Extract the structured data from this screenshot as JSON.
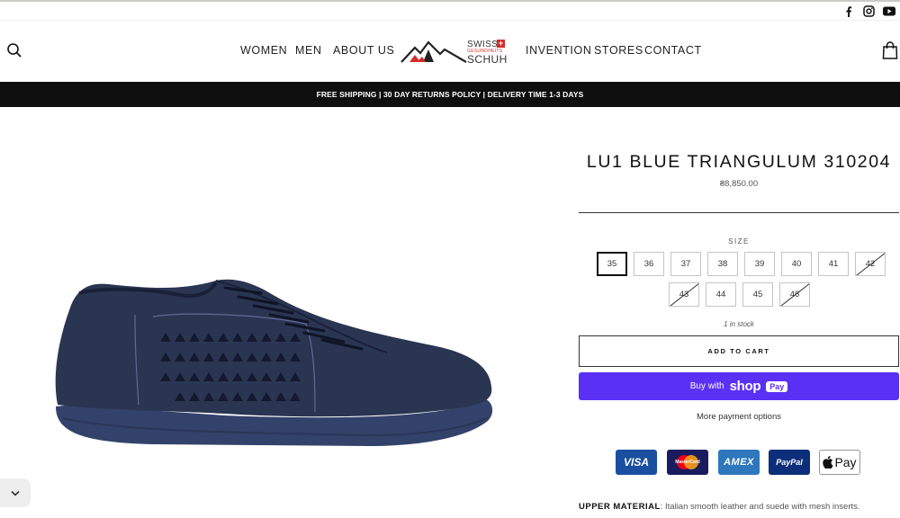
{
  "header": {
    "social_icons": [
      "facebook-icon",
      "instagram-icon",
      "youtube-icon"
    ],
    "nav_left": [
      "WOMEN",
      "MEN",
      "ABOUT US"
    ],
    "nav_right": [
      "INVENTION",
      "STORES",
      "CONTACT"
    ],
    "logo": {
      "brand_top": "SWISS",
      "brand_mid": "GESUNDHEITS",
      "brand_bottom": "SCHUH"
    },
    "icons": {
      "search": "search-icon",
      "cart": "shopping-bag-icon"
    }
  },
  "promo_bar": {
    "text": "FREE SHIPPING | 30 DAY RETURNS POLICY | DELIVERY TIME 1-3 DAYS"
  },
  "product": {
    "title": "LU1 BLUE TRIANGULUM 310204",
    "price": "₴8,850.00",
    "size_label": "SIZE",
    "sizes": [
      {
        "label": "35",
        "state": "selected"
      },
      {
        "label": "36",
        "state": "available"
      },
      {
        "label": "37",
        "state": "available"
      },
      {
        "label": "38",
        "state": "available"
      },
      {
        "label": "39",
        "state": "available"
      },
      {
        "label": "40",
        "state": "available"
      },
      {
        "label": "41",
        "state": "available"
      },
      {
        "label": "42",
        "state": "unavailable"
      },
      {
        "label": "43",
        "state": "unavailable"
      },
      {
        "label": "44",
        "state": "available"
      },
      {
        "label": "45",
        "state": "available"
      },
      {
        "label": "46",
        "state": "unavailable"
      }
    ],
    "stock": "1 in stock",
    "add_to_cart": "ADD TO CART",
    "shop_pay": {
      "buy_with": "Buy with",
      "shop": "shop",
      "pay": "Pay"
    },
    "more_payment": "More payment options",
    "payment_methods": [
      {
        "name": "VISA",
        "bg": "#1a4fa0",
        "fg": "#ffffff"
      },
      {
        "name": "MasterCard",
        "bg": "#1b1c5e",
        "fg": "#ffffff"
      },
      {
        "name": "AMEX",
        "bg": "#2e77bc",
        "fg": "#ffffff"
      },
      {
        "name": "PayPal",
        "bg": "#0d2f7a",
        "fg": "#ffffff"
      },
      {
        "name": "Pay",
        "bg": "#ffffff",
        "fg": "#111111"
      }
    ],
    "material_label": "UPPER MATERIAL",
    "material_text": ": Italian smooth leather and suede with mesh inserts."
  },
  "colors": {
    "promo_bar": "#0f0f0f",
    "shop_pay": "#5a31f4",
    "shoe": "#2a3552",
    "logo_red": "#d62b2b"
  }
}
